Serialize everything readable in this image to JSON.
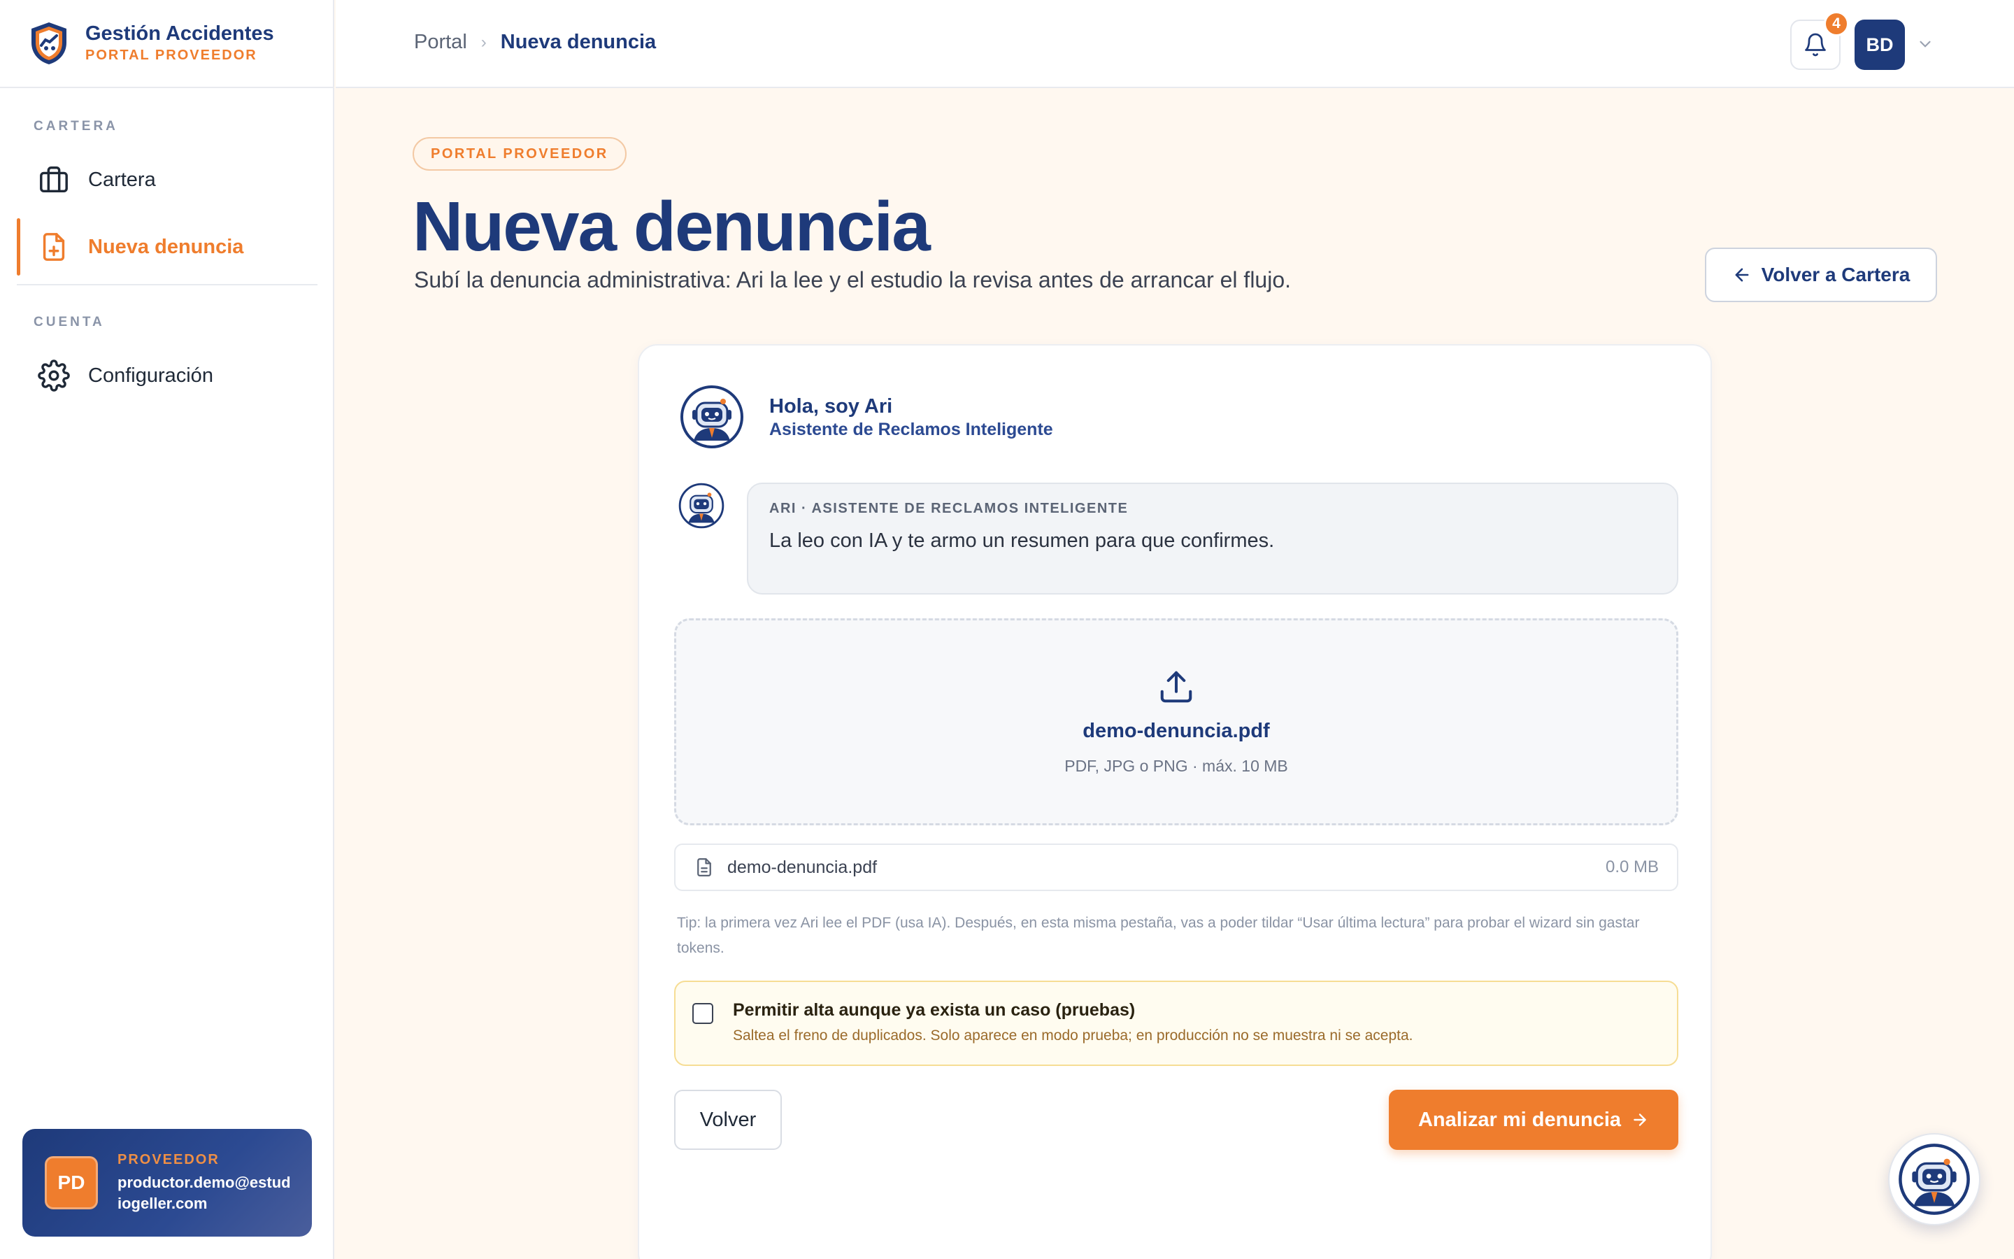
{
  "brand": {
    "name": "Gestión Accidentes",
    "subtitle": "PORTAL PROVEEDOR"
  },
  "sidebar": {
    "sections": [
      {
        "label": "CARTERA",
        "items": [
          {
            "label": "Cartera",
            "icon": "briefcase-icon"
          },
          {
            "label": "Nueva denuncia",
            "icon": "file-plus-icon",
            "active": true
          }
        ]
      },
      {
        "label": "CUENTA",
        "items": [
          {
            "label": "Configuración",
            "icon": "gear-icon"
          }
        ]
      }
    ],
    "user": {
      "initials": "PD",
      "role": "PROVEEDOR",
      "email": "productor.demo@estudiogeller.com"
    }
  },
  "topbar": {
    "breadcrumb": {
      "root": "Portal",
      "current": "Nueva denuncia"
    },
    "notifications_count": "4",
    "avatar_initials": "BD"
  },
  "page": {
    "badge": "PORTAL PROVEEDOR",
    "title": "Nueva denuncia",
    "subtitle": "Subí la denuncia administrativa: Ari la lee y el estudio la revisa antes de arrancar el flujo.",
    "back_button": "Volver a Cartera"
  },
  "assistant": {
    "greeting": "Hola, soy Ari",
    "role": "Asistente de Reclamos Inteligente",
    "message_label": "ARI · ASISTENTE DE RECLAMOS INTELIGENTE",
    "message": "La leo con IA y te armo un resumen para que confirmes."
  },
  "upload": {
    "filename": "demo-denuncia.pdf",
    "hint": "PDF, JPG o PNG · máx. 10 MB",
    "file": {
      "name": "demo-denuncia.pdf",
      "size": "0.0 MB"
    },
    "tip": "Tip: la primera vez Ari lee el PDF (usa IA). Después, en esta misma pestaña, vas a poder tildar “Usar última lectura” para probar el wizard sin gastar tokens."
  },
  "duplicate_override": {
    "checked": false,
    "title": "Permitir alta aunque ya exista un caso (pruebas)",
    "description": "Saltea el freno de duplicados. Solo aparece en modo prueba; en producción no se muestra ni se acepta."
  },
  "actions": {
    "back": "Volver",
    "submit": "Analizar mi denuncia"
  },
  "colors": {
    "primary": "#1e3a7a",
    "accent": "#ef7d2d",
    "background": "#fff8f0"
  }
}
